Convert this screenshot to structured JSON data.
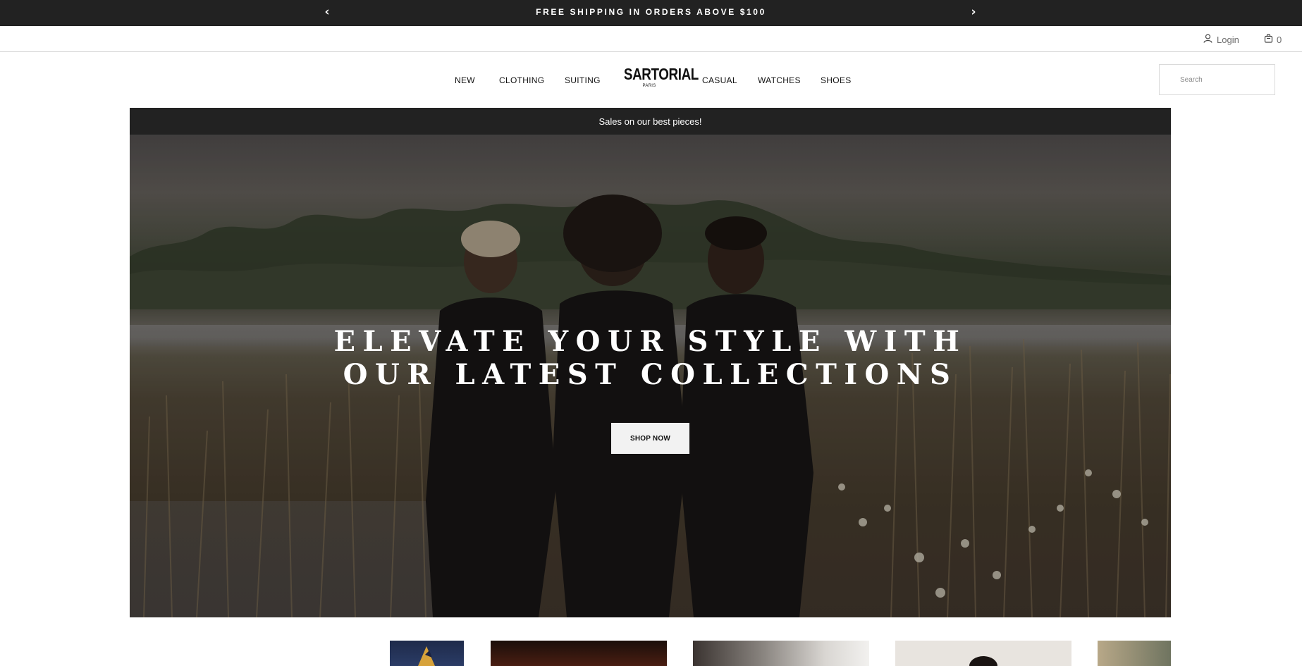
{
  "announcement": {
    "text": "FREE SHIPPING IN ORDERS ABOVE $100",
    "prev_arrow": "‹",
    "next_arrow": "›"
  },
  "utility": {
    "login_label": "Login",
    "login_icon": "user-icon",
    "cart_icon": "cart-icon",
    "cart_count": "0"
  },
  "nav": {
    "items": [
      {
        "label": "NEW"
      },
      {
        "label": "CLOTHING"
      },
      {
        "label": "SUITING"
      },
      {
        "label": "CASUAL"
      },
      {
        "label": "WATCHES"
      },
      {
        "label": "SHOES"
      }
    ],
    "logo_main": "SARTORIAL",
    "logo_sub": "PARIS"
  },
  "search": {
    "placeholder": "Search",
    "value": ""
  },
  "hero": {
    "banner": "Sales on our best pieces!",
    "headline_line1": "ELEVATE YOUR STYLE WITH",
    "headline_line2": "OUR LATEST COLLECTIONS",
    "cta_label": "SHOP NOW"
  },
  "colors": {
    "bar_dark": "#222222",
    "text_muted": "#6b6b6b",
    "cta_bg": "#f2f2f2"
  }
}
